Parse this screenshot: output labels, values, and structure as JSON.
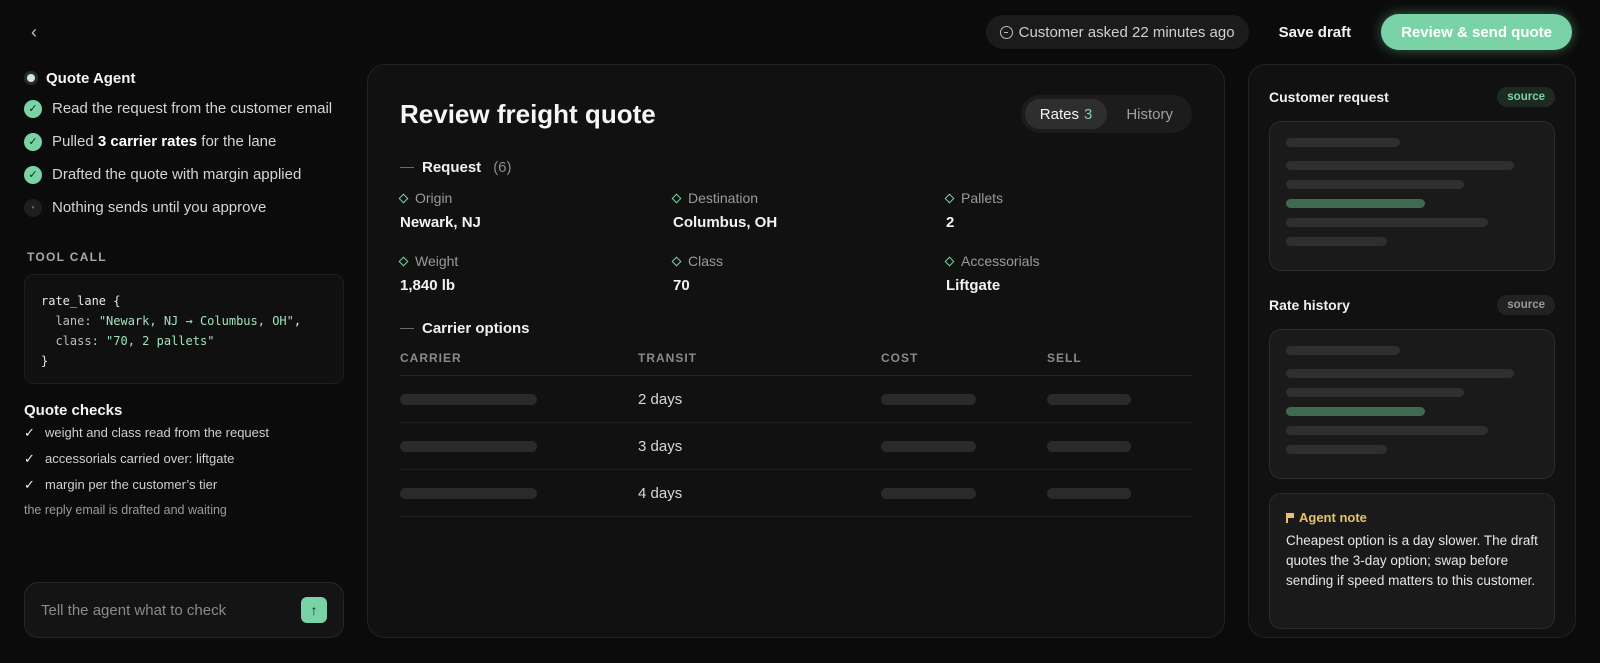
{
  "topbar": {
    "back_icon": "chevron-left-icon",
    "asked_text": "Customer asked 22 minutes ago",
    "save_label": "Save draft",
    "send_label": "Review & send quote"
  },
  "agent": {
    "title": "Quote Agent",
    "steps": [
      {
        "pre": "Read the request from the customer email",
        "bold": "",
        "post": "",
        "done": true
      },
      {
        "pre": "Pulled ",
        "bold": "3 carrier rates",
        "post": " for the lane",
        "done": true
      },
      {
        "pre": "Drafted the quote with margin applied",
        "bold": "",
        "post": "",
        "done": true
      },
      {
        "pre": "Nothing sends until you approve",
        "bold": "",
        "post": "",
        "done": false
      }
    ],
    "tool_call_label": "TOOL CALL",
    "code": {
      "fn": "rate_lane",
      "open": "{",
      "lane_key": "lane:",
      "lane_val": "\"Newark, NJ → Columbus, OH\"",
      "class_key": "class:",
      "class_val": "\"70, 2 pallets\"",
      "close": "}"
    },
    "checks_title": "Quote checks",
    "checks": [
      "weight and class read from the request",
      "accessorials carried over: liftgate",
      "margin per the customer’s tier"
    ],
    "waiting_text": "the reply email is drafted and waiting",
    "prompt_placeholder": "Tell the agent what to check"
  },
  "main": {
    "title": "Review freight quote",
    "tabs": [
      {
        "label": "Rates",
        "count": "3",
        "active": true
      },
      {
        "label": "History",
        "count": "",
        "active": false
      }
    ],
    "request": {
      "heading": "Request",
      "count": "(6)",
      "fields": [
        {
          "label": "Origin",
          "value": "Newark, NJ"
        },
        {
          "label": "Destination",
          "value": "Columbus, OH"
        },
        {
          "label": "Pallets",
          "value": "2"
        },
        {
          "label": "Weight",
          "value": "1,840 lb"
        },
        {
          "label": "Class",
          "value": "70"
        },
        {
          "label": "Accessorials",
          "value": "Liftgate"
        }
      ]
    },
    "carriers": {
      "heading": "Carrier options",
      "columns": [
        "CARRIER",
        "TRANSIT",
        "COST",
        "SELL"
      ],
      "rows": [
        {
          "transit": "2 days"
        },
        {
          "transit": "3 days"
        },
        {
          "transit": "4 days"
        }
      ]
    }
  },
  "sidebar": {
    "customer_request": {
      "title": "Customer request",
      "badge": "source"
    },
    "rate_history": {
      "title": "Rate history",
      "badge": "source"
    },
    "note": {
      "title": "Agent note",
      "body": "Cheapest option is a day slower. The draft quotes the 3-day option; swap before sending if speed matters to this customer."
    }
  },
  "colors": {
    "accent": "#7ad3a6",
    "note_accent": "#e8c26a",
    "background": "#0b0b0b",
    "card": "#111111"
  }
}
